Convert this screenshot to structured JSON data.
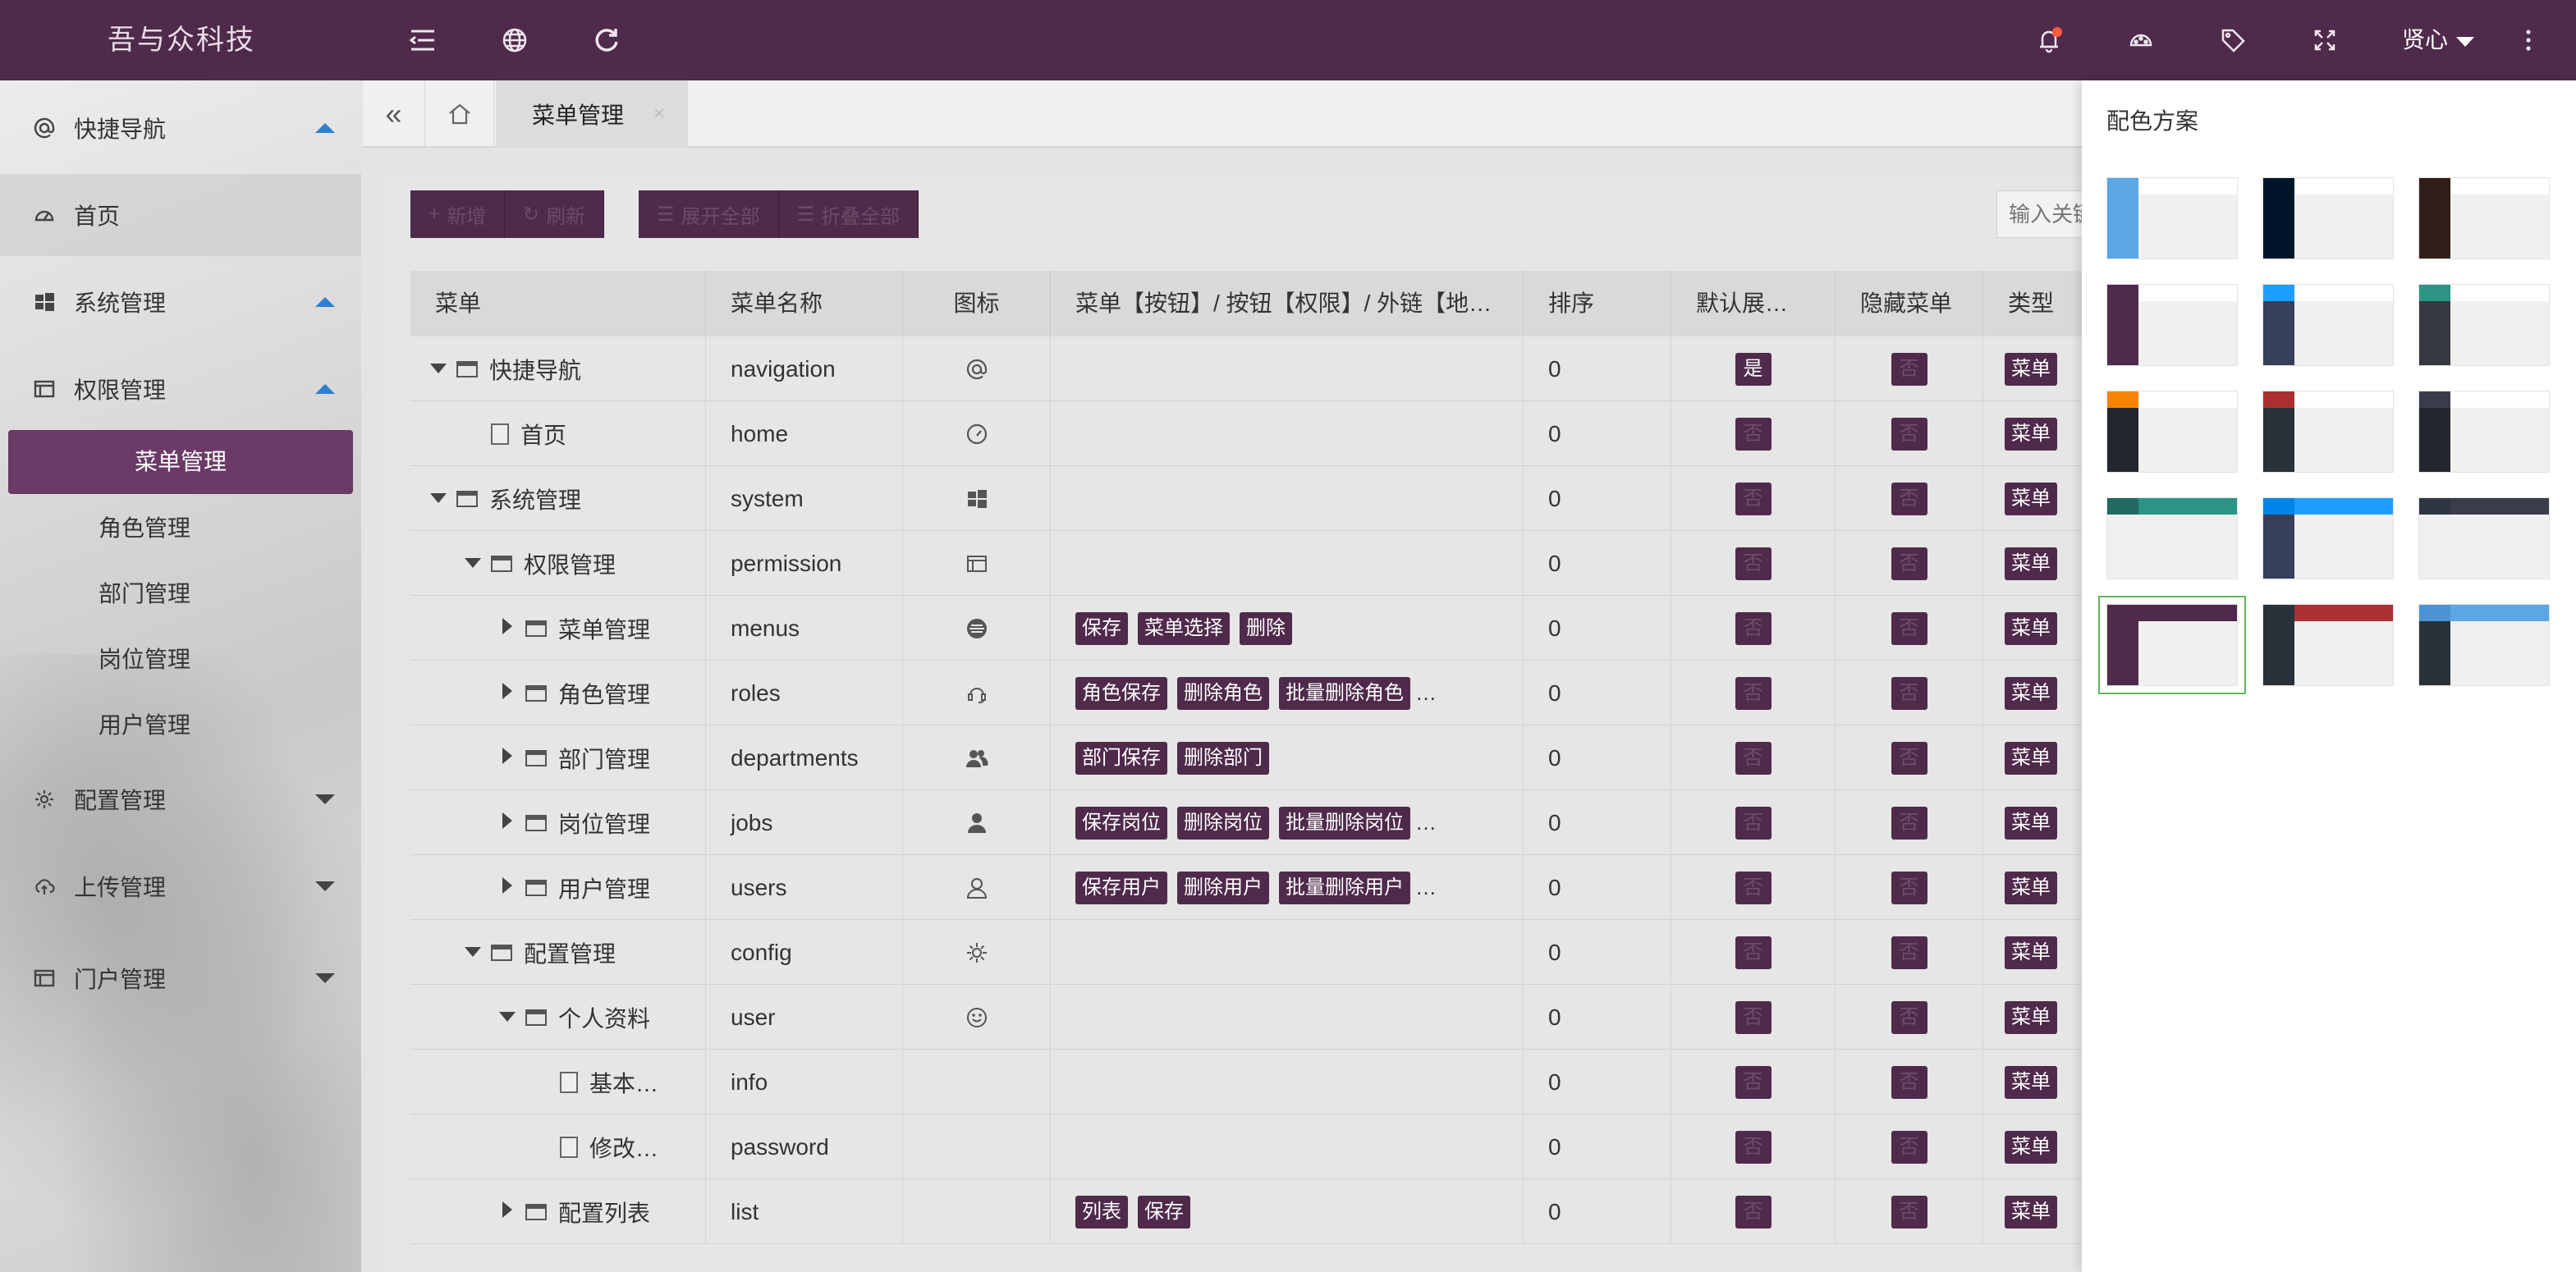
{
  "app": {
    "logo": "吾与众科技",
    "user": "贤心"
  },
  "topbar": {
    "icons": [
      "menu-collapse-icon",
      "globe-icon",
      "refresh-icon",
      "bell-icon",
      "theme-palette-icon",
      "tag-icon",
      "fullscreen-icon",
      "more-icon"
    ]
  },
  "sidebar": {
    "items": [
      {
        "label": "快捷导航",
        "icon": "at-icon",
        "expanded": true
      },
      {
        "label": "首页",
        "icon": "dashboard-icon",
        "active": true
      },
      {
        "label": "系统管理",
        "icon": "windows-icon",
        "expanded": true
      },
      {
        "label": "权限管理",
        "icon": "window-icon",
        "expanded": true
      },
      {
        "label": "配置管理",
        "icon": "gear-icon",
        "expanded": false
      },
      {
        "label": "上传管理",
        "icon": "cloud-upload-icon",
        "expanded": false
      },
      {
        "label": "门户管理",
        "icon": "window-icon",
        "expanded": false
      }
    ],
    "sub_items": [
      {
        "label": "菜单管理",
        "selected": true
      },
      {
        "label": "角色管理"
      },
      {
        "label": "部门管理"
      },
      {
        "label": "岗位管理"
      },
      {
        "label": "用户管理"
      }
    ]
  },
  "tabs": {
    "active": "菜单管理",
    "close": "×"
  },
  "toolbar": {
    "add": "新增",
    "refresh": "刷新",
    "expand_all": "展开全部",
    "collapse_all": "折叠全部",
    "search_placeholder": "输入关键"
  },
  "table": {
    "headers": [
      "菜单",
      "菜单名称",
      "图标",
      "菜单【按钮】/ 按钮【权限】/ 外链【地…",
      "排序",
      "默认展…",
      "隐藏菜单",
      "类型"
    ],
    "rows": [
      {
        "title": "快捷导航",
        "name": "navigation",
        "icon": "at-icon",
        "tags": [],
        "more": "",
        "sort": "0",
        "default_expand": "是",
        "hidden": "否",
        "type": "菜单",
        "level": 0,
        "caret": "down",
        "kind": "folder"
      },
      {
        "title": "首页",
        "name": "home",
        "icon": "dashboard-icon",
        "tags": [],
        "more": "",
        "sort": "0",
        "default_expand": "否",
        "hidden": "否",
        "type": "菜单",
        "level": 1,
        "caret": "",
        "kind": "file"
      },
      {
        "title": "系统管理",
        "name": "system",
        "icon": "windows-icon",
        "tags": [],
        "more": "",
        "sort": "0",
        "default_expand": "否",
        "hidden": "否",
        "type": "菜单",
        "level": 0,
        "caret": "down",
        "kind": "folder"
      },
      {
        "title": "权限管理",
        "name": "permission",
        "icon": "window-icon",
        "tags": [],
        "more": "",
        "sort": "0",
        "default_expand": "否",
        "hidden": "否",
        "type": "菜单",
        "level": 1,
        "caret": "down",
        "kind": "folder"
      },
      {
        "title": "菜单管理",
        "name": "menus",
        "icon": "menu-circle-icon",
        "tags": [
          "保存",
          "菜单选择",
          "删除"
        ],
        "more": "",
        "sort": "0",
        "default_expand": "否",
        "hidden": "否",
        "type": "菜单",
        "level": 2,
        "caret": "right",
        "kind": "folder"
      },
      {
        "title": "角色管理",
        "name": "roles",
        "icon": "headset-icon",
        "tags": [
          "角色保存",
          "删除角色",
          "批量删除角色"
        ],
        "more": "…",
        "sort": "0",
        "default_expand": "否",
        "hidden": "否",
        "type": "菜单",
        "level": 2,
        "caret": "right",
        "kind": "folder"
      },
      {
        "title": "部门管理",
        "name": "departments",
        "icon": "users-icon",
        "tags": [
          "部门保存",
          "删除部门"
        ],
        "more": "",
        "sort": "0",
        "default_expand": "否",
        "hidden": "否",
        "type": "菜单",
        "level": 2,
        "caret": "right",
        "kind": "folder"
      },
      {
        "title": "岗位管理",
        "name": "jobs",
        "icon": "user-icon",
        "tags": [
          "保存岗位",
          "删除岗位",
          "批量删除岗位"
        ],
        "more": "…",
        "sort": "0",
        "default_expand": "否",
        "hidden": "否",
        "type": "菜单",
        "level": 2,
        "caret": "right",
        "kind": "folder"
      },
      {
        "title": "用户管理",
        "name": "users",
        "icon": "user-outline-icon",
        "tags": [
          "保存用户",
          "删除用户",
          "批量删除用户"
        ],
        "more": "…",
        "sort": "0",
        "default_expand": "否",
        "hidden": "否",
        "type": "菜单",
        "level": 2,
        "caret": "right",
        "kind": "folder"
      },
      {
        "title": "配置管理",
        "name": "config",
        "icon": "gear-icon",
        "tags": [],
        "more": "",
        "sort": "0",
        "default_expand": "否",
        "hidden": "否",
        "type": "菜单",
        "level": 1,
        "caret": "down",
        "kind": "folder"
      },
      {
        "title": "个人资料",
        "name": "user",
        "icon": "smile-icon",
        "tags": [],
        "more": "",
        "sort": "0",
        "default_expand": "否",
        "hidden": "否",
        "type": "菜单",
        "level": 2,
        "caret": "down",
        "kind": "folder"
      },
      {
        "title": "基本…",
        "name": "info",
        "icon": "",
        "tags": [],
        "more": "",
        "sort": "0",
        "default_expand": "否",
        "hidden": "否",
        "type": "菜单",
        "level": 3,
        "caret": "",
        "kind": "file"
      },
      {
        "title": "修改…",
        "name": "password",
        "icon": "",
        "tags": [],
        "more": "",
        "sort": "0",
        "default_expand": "否",
        "hidden": "否",
        "type": "菜单",
        "level": 3,
        "caret": "",
        "kind": "file"
      },
      {
        "title": "配置列表",
        "name": "list",
        "icon": "",
        "tags": [
          "列表",
          "保存"
        ],
        "more": "",
        "sort": "0",
        "default_expand": "否",
        "hidden": "否",
        "type": "菜单",
        "level": 2,
        "caret": "right",
        "kind": "folder"
      }
    ]
  },
  "theme_panel": {
    "title": "配色方案",
    "selected_index": 12,
    "swatches": [
      {
        "side": "#3b3b3b",
        "logo": "#5aa7e3",
        "top": "#ffffff",
        "side_color": "#5aa7e3"
      },
      {
        "side": "#01152a",
        "logo": "#01152a",
        "top": "#ffffff"
      },
      {
        "side": "#2f1f18",
        "logo": "#2f1f18",
        "top": "#ffffff"
      },
      {
        "side": "#4f2a4b",
        "logo": "#4f2a4b",
        "top": "#ffffff"
      },
      {
        "side": "#36405a",
        "logo": "#1e9fff",
        "top": "#ffffff"
      },
      {
        "side": "#36393f",
        "logo": "#2b9484",
        "top": "#ffffff"
      },
      {
        "side": "#22262d",
        "logo": "#f78400",
        "top": "#ffffff"
      },
      {
        "side": "#283238",
        "logo": "#aa3130",
        "top": "#ffffff"
      },
      {
        "side": "#22262d",
        "logo": "#3a3d49",
        "top": "#ffffff"
      },
      {
        "side": "#f0f0f0",
        "logo": "#226a62",
        "top": "#2b9484"
      },
      {
        "side": "#36405a",
        "logo": "#0085e8",
        "top": "#1e9fff"
      },
      {
        "side": "#f0f0f0",
        "logo": "#2f3542",
        "top": "#3a3d49"
      },
      {
        "side": "#4f2a4b",
        "logo": "#4f2a4b",
        "top": "#4f2a4b"
      },
      {
        "side": "#283238",
        "logo": "#283238",
        "top": "#aa3130"
      },
      {
        "side": "#283238",
        "logo": "#4b93d4",
        "top": "#5aa7e3"
      }
    ]
  },
  "colors": {
    "primary": "#4f2a4b",
    "selected_sidebar": "#6b3a66",
    "selected_swatch_border": "#5cb85c"
  }
}
